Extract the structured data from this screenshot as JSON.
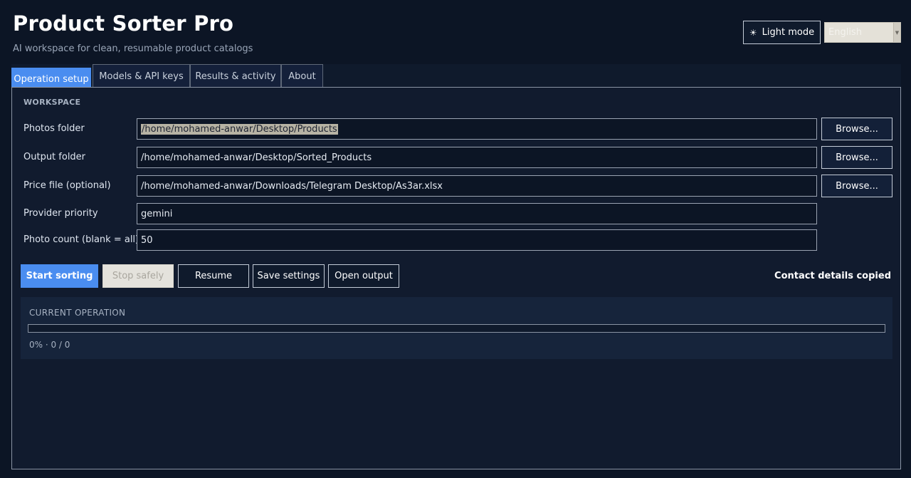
{
  "header": {
    "title": "Product Sorter Pro",
    "subtitle": "AI workspace for clean, resumable product catalogs",
    "theme_button": "Light mode",
    "theme_icon": "sun-icon",
    "language": "English"
  },
  "tabs": [
    {
      "label": "Operation setup",
      "active": true
    },
    {
      "label": "Models & API keys",
      "active": false
    },
    {
      "label": "Results & activity",
      "active": false
    },
    {
      "label": "About",
      "active": false
    }
  ],
  "workspace": {
    "section_label": "WORKSPACE",
    "browse_label": "Browse...",
    "photos_label": "Photos folder",
    "photos_value": "/home/mohamed-anwar/Desktop/Products",
    "output_label": "Output folder",
    "output_value": "/home/mohamed-anwar/Desktop/Sorted_Products",
    "price_label": "Price file (optional)",
    "price_value": "/home/mohamed-anwar/Downloads/Telegram Desktop/As3ar.xlsx",
    "provider_label": "Provider priority",
    "provider_value": "gemini",
    "count_label": "Photo count (blank = all)",
    "count_value": "50"
  },
  "actions": {
    "start": "Start sorting",
    "stop": "Stop safely",
    "resume": "Resume",
    "save": "Save settings",
    "open": "Open output",
    "status": "Contact details copied"
  },
  "operation": {
    "title": "CURRENT OPERATION",
    "progress_percent": 0,
    "stats": "0% · 0 / 0"
  },
  "colors": {
    "accent": "#4a8df0",
    "background": "#0c1525"
  }
}
